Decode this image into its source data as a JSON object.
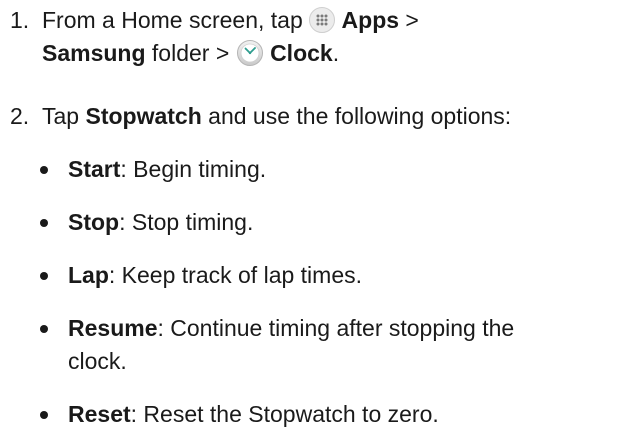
{
  "steps": [
    {
      "number": "1.",
      "line1_prefix": "From a Home screen, tap ",
      "apps_label": "Apps",
      "line1_suffix": " >",
      "samsung_label": "Samsung",
      "line2_mid": " folder > ",
      "clock_label": "Clock",
      "line2_suffix": "."
    },
    {
      "number": "2.",
      "prefix": "Tap ",
      "stopwatch_label": "Stopwatch",
      "suffix": " and use the following options:"
    }
  ],
  "options": [
    {
      "term": "Start",
      "desc": ": Begin timing."
    },
    {
      "term": "Stop",
      "desc": ": Stop timing."
    },
    {
      "term": "Lap",
      "desc": ": Keep track of lap times."
    },
    {
      "term": "Resume",
      "desc": ": Continue timing after stopping the",
      "desc_line2": "clock."
    },
    {
      "term": "Reset",
      "desc": ": Reset the Stopwatch to zero."
    }
  ],
  "icons": {
    "apps": "apps-grid-icon",
    "clock": "clock-icon"
  }
}
